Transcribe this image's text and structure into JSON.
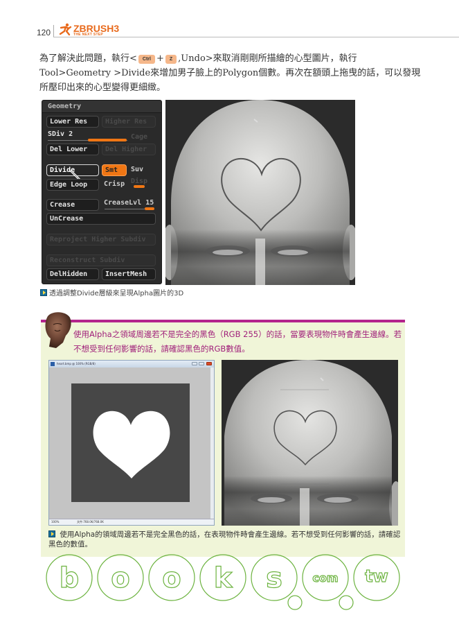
{
  "header": {
    "page_number": "120",
    "logo": {
      "main": "ZBRUSH3",
      "sub": "THE NEXT STEP",
      "icon": "running-figure-icon"
    },
    "brand_color": "#e86a1c"
  },
  "body_text": {
    "part1": "為了解決此問題，執行<",
    "key1": "Ctrl",
    "plus": "+",
    "key2": "Z",
    "part2": ",Undo>來取消剛剛所描繪的心型圖片，執行Tool>Geometry >Divide來增加男子臉上的Polygon個數。再次在額頭上拖曳的話，可以發現所壓印出來的心型變得更細緻。"
  },
  "geometry_panel": {
    "title": "Geometry",
    "lower_res": "Lower Res",
    "higher_res": "Higher Res",
    "sdiv_label": "SDiv 2",
    "sdiv_value": 2,
    "sdiv_max": 2,
    "cage": "Cage",
    "del_lower": "Del Lower",
    "del_higher": "Del Higher",
    "divide": "Divide",
    "smt": "Smt",
    "suv": "Suv",
    "edge_loop": "Edge Loop",
    "crisp": "Crisp",
    "disp": "Disp",
    "crease": "Crease",
    "crease_lvl_label": "CreaseLvl",
    "crease_lvl_value": "15",
    "uncrease": "UnCrease",
    "reproject": "Reproject Higher Subdiv",
    "reconstruct": "Reconstruct Subdiv",
    "del_hidden": "DelHidden",
    "insert_mesh": "InsertMesh",
    "accent_color": "#f07614"
  },
  "caption1": "透過調整Divide層級來呈現Alpha圖片的3D",
  "tip": {
    "text": "使用Alpha之領域周邊若不是完全的黑色（RGB 255）的話，當要表現物件時會產生邊線。若不想受到任何影響的話，請確認黑色的RGB數值。",
    "bar_color": "#b4248c",
    "bg_color": "#f0f5d8",
    "text_color": "#a0207a"
  },
  "photoshop_window": {
    "title": "heart.bmp @ 100% (RGB/8)",
    "zoom": "100%",
    "doc_info": "文件:768.0K/768.0K"
  },
  "caption2": "使用Alpha的領域周邊若不是完全黑色的話，在表現物件時會產生邊線。若不想受到任何影響的話，請確認黑色的數值。",
  "watermark": {
    "letters": [
      "b",
      "o",
      "o",
      "k",
      "s",
      "com",
      "tw"
    ]
  }
}
